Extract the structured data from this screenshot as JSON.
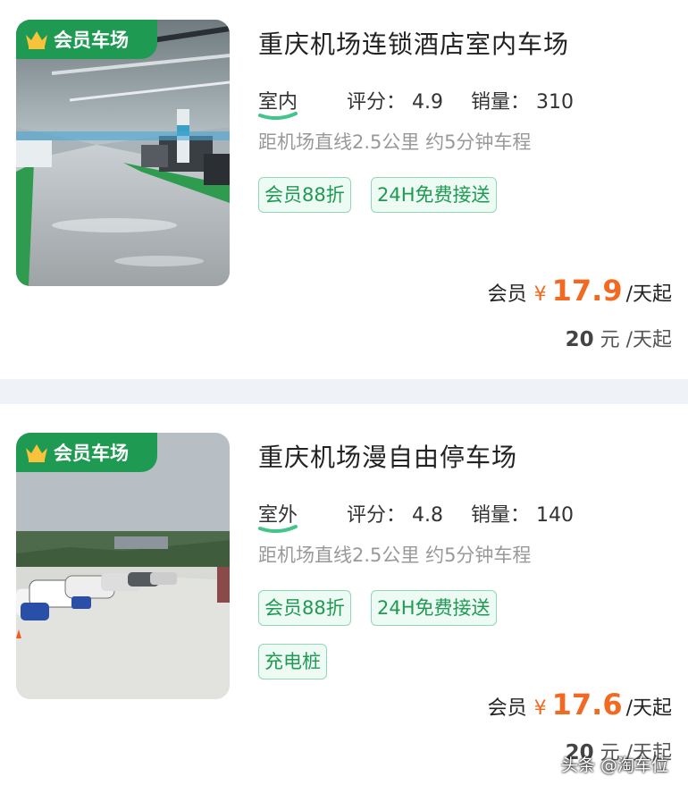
{
  "listings": [
    {
      "badge": "会员车场",
      "title": "重庆机场连锁酒店室内车场",
      "location_type": "室内",
      "rating_label": "评分：",
      "rating": "4.9",
      "sales_label": "销量：",
      "sales": "310",
      "distance": "距机场直线2.5公里 约5分钟车程",
      "tags": [
        "会员88折",
        "24H免费接送"
      ],
      "price_label": "会员",
      "currency": "¥",
      "price": "17.9",
      "price_unit": "/天起",
      "original_price": "20",
      "original_unit": "元 /天起"
    },
    {
      "badge": "会员车场",
      "title": "重庆机场漫自由停车场",
      "location_type": "室外",
      "rating_label": "评分：",
      "rating": "4.8",
      "sales_label": "销量：",
      "sales": "140",
      "distance": "距机场直线2.5公里 约5分钟车程",
      "tags": [
        "会员88折",
        "24H免费接送",
        "充电桩"
      ],
      "price_label": "会员",
      "currency": "¥",
      "price": "17.6",
      "price_unit": "/天起",
      "original_price": "20",
      "original_unit": "元 /天起"
    }
  ],
  "watermark": "头条 @淘车位",
  "colors": {
    "brand_green": "#1f9a52",
    "price_orange": "#f26a21",
    "tag_border": "#8fd9b6",
    "tag_bg": "#eefaf4"
  },
  "icons": {
    "badge": "crown-icon"
  }
}
